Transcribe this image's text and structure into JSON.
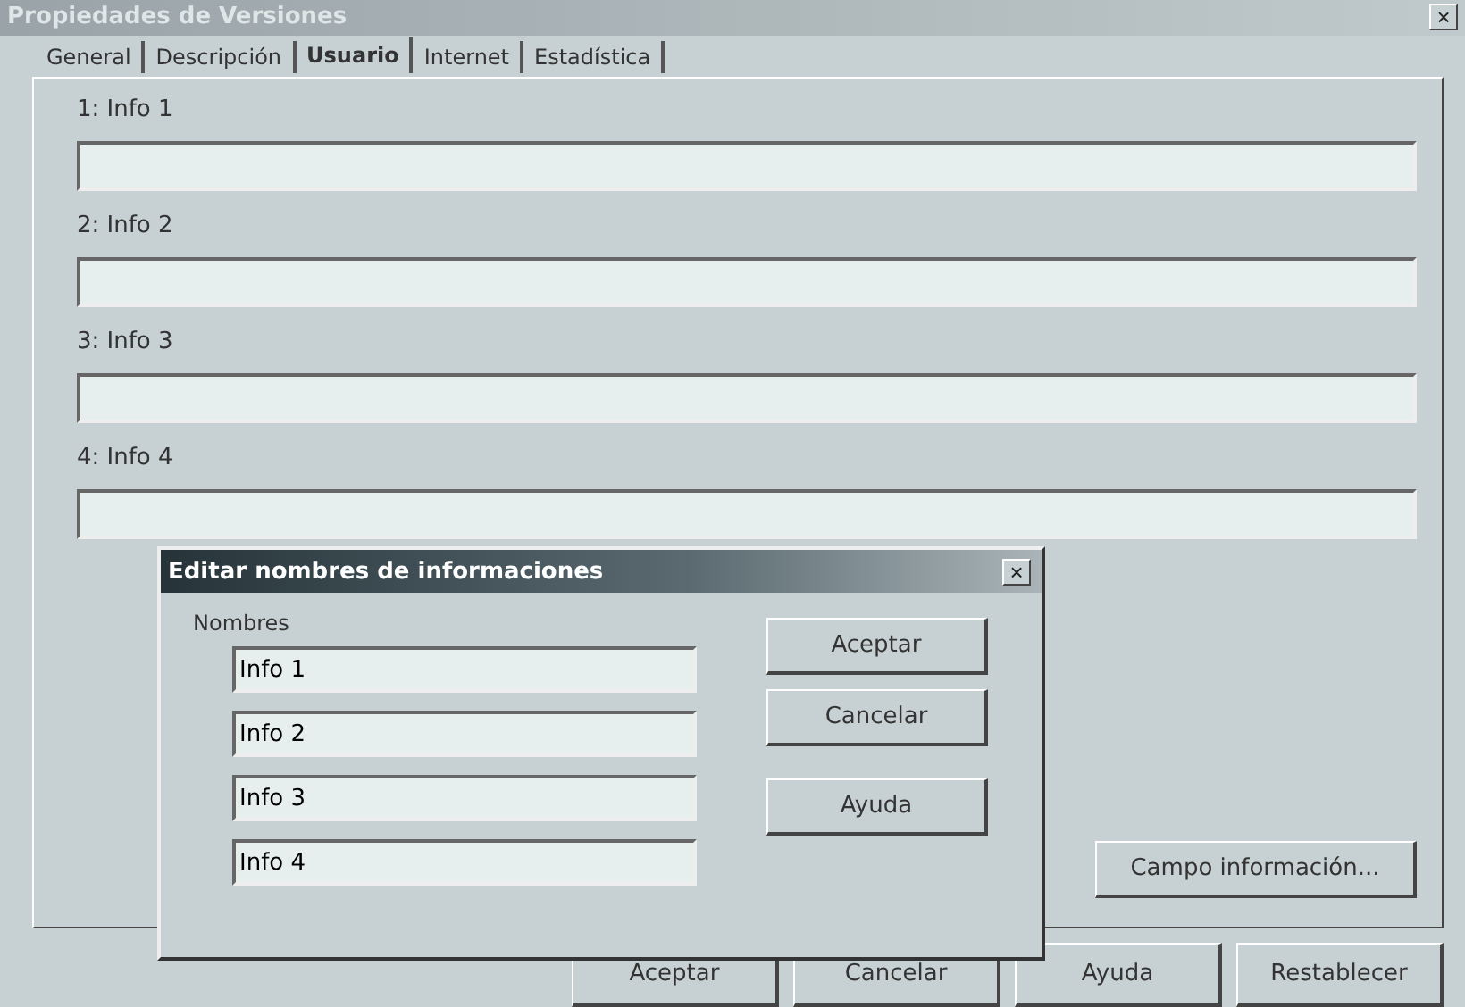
{
  "window": {
    "title": "Propiedades de Versiones",
    "close": "×"
  },
  "tabs": [
    {
      "label": "General",
      "selected": false
    },
    {
      "label": "Descripción",
      "selected": false
    },
    {
      "label": "Usuario",
      "selected": true
    },
    {
      "label": "Internet",
      "selected": false
    },
    {
      "label": "Estadística",
      "selected": false
    }
  ],
  "fields": [
    {
      "label": "1: Info 1"
    },
    {
      "label": "2: Info 2"
    },
    {
      "label": "3: Info 3"
    },
    {
      "label": "4: Info 4"
    }
  ],
  "info_button": "Campo información...",
  "buttons": [
    "Aceptar",
    "Cancelar",
    "Ayuda",
    "Restablecer"
  ],
  "subdialog": {
    "title": "Editar nombres de informaciones",
    "close": "×",
    "group": "Nombres",
    "names": [
      "Info 1",
      "Info 2",
      "Info 3",
      "Info 4"
    ],
    "buttons": [
      "Aceptar",
      "Cancelar",
      "Ayuda"
    ]
  }
}
